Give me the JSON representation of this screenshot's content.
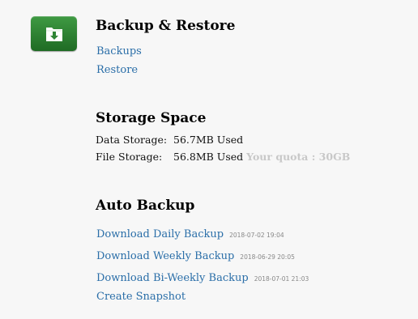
{
  "backup_restore": {
    "icon": "download-folder-icon",
    "title": "Backup & Restore",
    "links": {
      "backups": "Backups",
      "restore": "Restore"
    }
  },
  "storage": {
    "title": "Storage Space",
    "data_label": "Data Storage:",
    "data_value": "56.7MB Used",
    "file_label": "File Storage:",
    "file_value": "56.8MB Used",
    "quota": "Your quota : 30GB"
  },
  "auto_backup": {
    "title": "Auto Backup",
    "daily": {
      "label": "Download Daily Backup",
      "date": "2018-07-02 19:04"
    },
    "weekly": {
      "label": "Download Weekly Backup",
      "date": "2018-06-29 20:05"
    },
    "biweekly": {
      "label": "Download Bi-Weekly Backup",
      "date": "2018-07-01 21:03"
    },
    "snapshot": "Create Snapshot"
  },
  "colors": {
    "link": "#2a6ea8",
    "icon_green": "#2e8534",
    "quota_text": "#c8c8c8"
  }
}
